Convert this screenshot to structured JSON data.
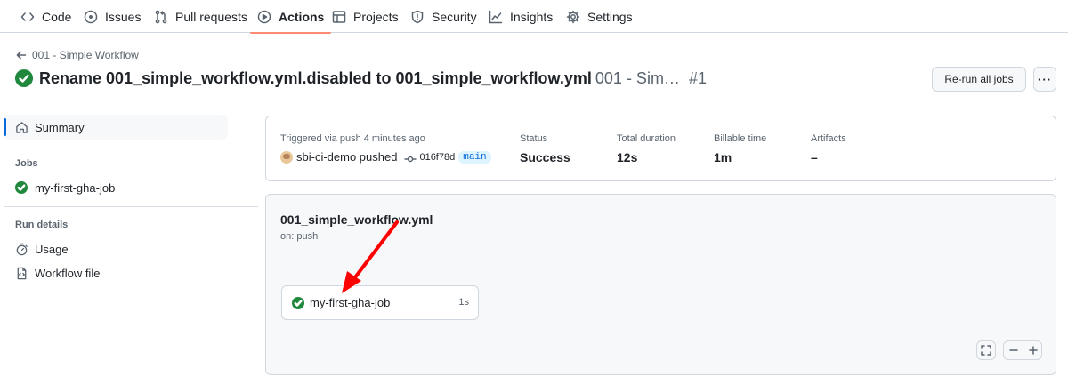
{
  "nav": {
    "tabs": [
      {
        "label": "Code",
        "icon": "code-icon"
      },
      {
        "label": "Issues",
        "icon": "issue-opened-icon"
      },
      {
        "label": "Pull requests",
        "icon": "git-pull-request-icon"
      },
      {
        "label": "Actions",
        "icon": "play-icon",
        "active": true
      },
      {
        "label": "Projects",
        "icon": "table-icon"
      },
      {
        "label": "Security",
        "icon": "shield-icon"
      },
      {
        "label": "Insights",
        "icon": "graph-icon"
      },
      {
        "label": "Settings",
        "icon": "gear-icon"
      }
    ]
  },
  "header": {
    "back_label": "001 - Simple Workflow",
    "title": "Rename 001_simple_workflow.yml.disabled to 001_simple_workflow.yml",
    "workflow_short": "001 - Sim…",
    "run_number": "#1",
    "rerun_label": "Re-run all jobs",
    "more_label": "···"
  },
  "sidebar": {
    "summary_label": "Summary",
    "jobs_heading": "Jobs",
    "jobs": [
      {
        "label": "my-first-gha-job",
        "status": "success"
      }
    ],
    "run_details_heading": "Run details",
    "details": [
      {
        "label": "Usage",
        "icon": "stopwatch-icon"
      },
      {
        "label": "Workflow file",
        "icon": "file-code-icon"
      }
    ]
  },
  "summary": {
    "trigger_text": "Triggered via push 4 minutes ago",
    "actor_text": "sbi-ci-demo pushed",
    "commit_sha": "016f78d",
    "branch": "main",
    "status_label": "Status",
    "status_value": "Success",
    "duration_label": "Total duration",
    "duration_value": "12s",
    "billable_label": "Billable time",
    "billable_value": "1m",
    "artifacts_label": "Artifacts",
    "artifacts_value": "–"
  },
  "graph": {
    "workflow_file": "001_simple_workflow.yml",
    "trigger": "on: push",
    "job": {
      "label": "my-first-gha-job",
      "duration": "1s",
      "status": "success"
    }
  },
  "colors": {
    "success": "#1f883d",
    "accent": "#0969da",
    "active_tab_underline": "#fd8c73",
    "annotation_arrow": "#ff0000"
  }
}
